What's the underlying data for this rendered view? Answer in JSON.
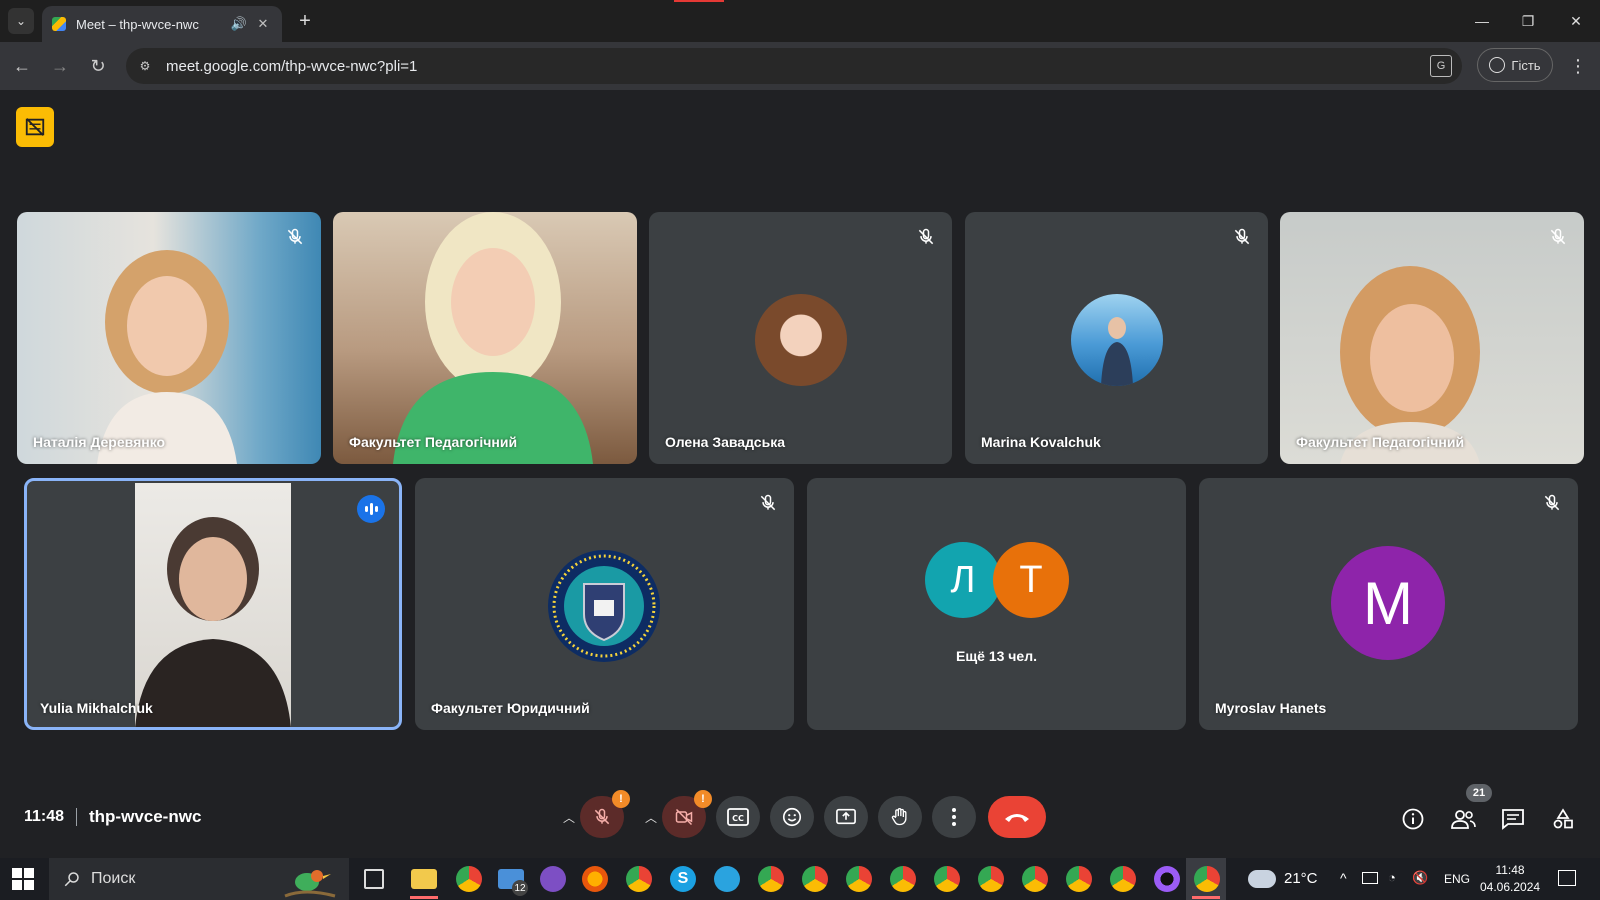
{
  "browser": {
    "tab_title": "Meet – thp-wvce-nwc",
    "url": "meet.google.com/thp-wvce-nwc?pli=1",
    "profile_label": "Гість"
  },
  "participants": [
    {
      "name": "Наталія Деревянко",
      "muted": true,
      "type": "video"
    },
    {
      "name": "Факультет Педагогічний",
      "muted": false,
      "type": "video"
    },
    {
      "name": "Олена Завадська",
      "muted": true,
      "type": "avatar-photo"
    },
    {
      "name": "Marina Kovalchuk",
      "muted": true,
      "type": "avatar-photo"
    },
    {
      "name": "Факультет Педагогічний",
      "muted": true,
      "type": "video"
    },
    {
      "name": "Yulia Mikhalchuk",
      "muted": false,
      "type": "video",
      "speaking": true
    },
    {
      "name": "Факультет Юридичний",
      "muted": true,
      "type": "logo"
    },
    {
      "name": "Myroslav Hanets",
      "muted": true,
      "type": "letter",
      "letter": "M",
      "color": "#8e24aa"
    }
  ],
  "others": {
    "letters": [
      "Л",
      "Т"
    ],
    "colors": [
      "#12a4af",
      "#e8710a"
    ],
    "label": "Ещё 13 чел."
  },
  "meeting": {
    "time": "11:48",
    "code": "thp-wvce-nwc",
    "people_count": "21"
  },
  "controls": {
    "mic_warning": "!",
    "cam_warning": "!"
  },
  "taskbar": {
    "search_placeholder": "Поиск",
    "mail_badge": "12",
    "temperature": "21°C",
    "language": "ENG",
    "clock_time": "11:48",
    "clock_date": "04.06.2024"
  },
  "colors": {
    "background": "#202124",
    "tile": "#3c4043",
    "speaking_border": "#8ab4f8",
    "leave": "#ea4335"
  }
}
